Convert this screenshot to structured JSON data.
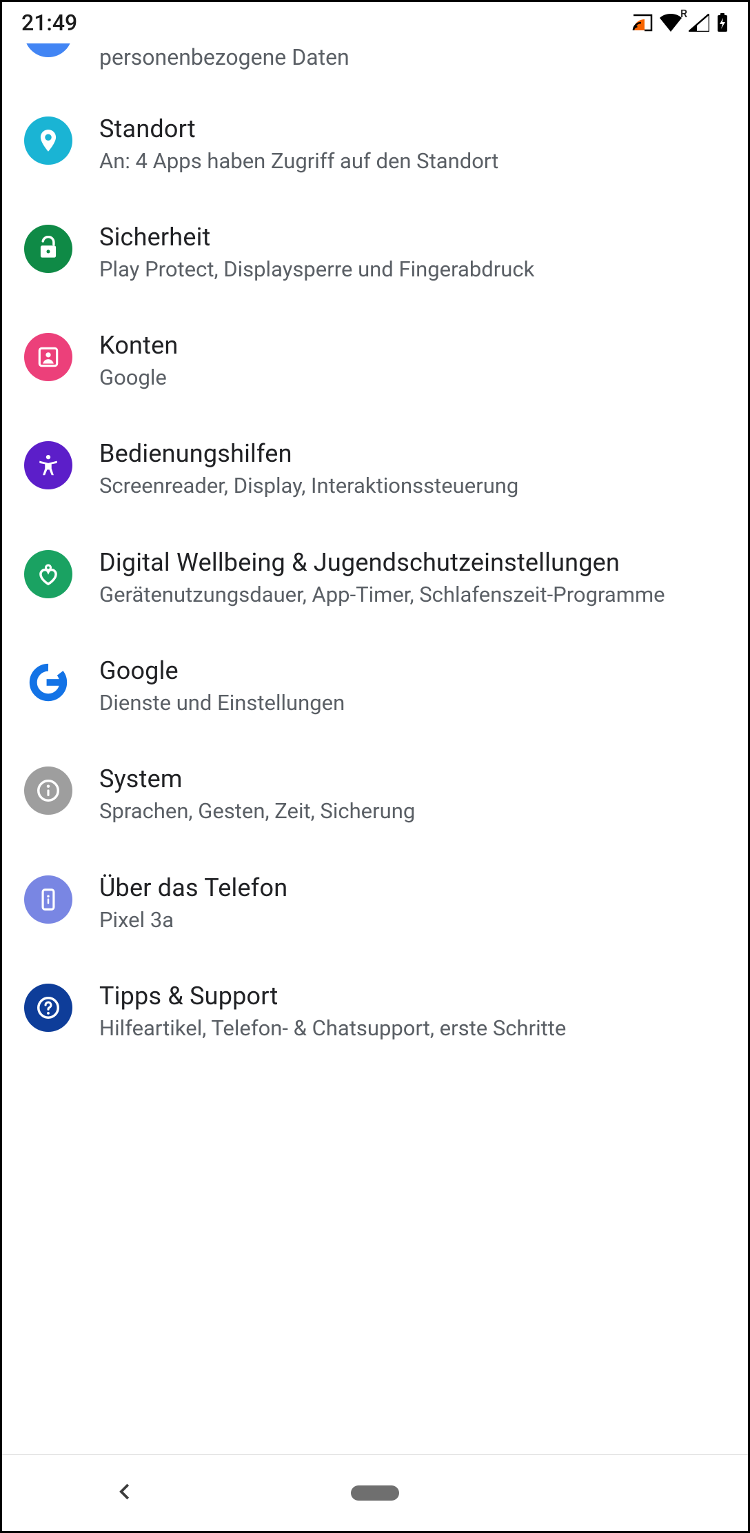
{
  "statusbar": {
    "time": "21:49",
    "signal_label": "R"
  },
  "partial": {
    "subtitle_fragment": "personenbezogene Daten"
  },
  "menu": [
    {
      "id": "standort",
      "title": "Standort",
      "subtitle": "An: 4 Apps haben Zugriff auf den Standort",
      "icon": "location",
      "color": "#1ab4d4"
    },
    {
      "id": "sicherheit",
      "title": "Sicherheit",
      "subtitle": "Play Protect, Displaysperre und Fingerabdruck",
      "icon": "lock-open",
      "color": "#0f8a46"
    },
    {
      "id": "konten",
      "title": "Konten",
      "subtitle": "Google",
      "icon": "account",
      "color": "#ec407a"
    },
    {
      "id": "bedienung",
      "title": "Bedienungshilfen",
      "subtitle": "Screenreader, Display, Interaktionssteuerung",
      "icon": "accessibility",
      "color": "#5c1ec9"
    },
    {
      "id": "wellbeing",
      "title": "Digital Wellbeing & Jugendschutzeinstellungen",
      "subtitle": "Gerätenutzungsdauer, App-Timer, Schlafenszeit-Programme",
      "icon": "wellbeing",
      "color": "#1aa262"
    },
    {
      "id": "google",
      "title": "Google",
      "subtitle": "Dienste und Einstellungen",
      "icon": "google",
      "color": "#1373e6"
    },
    {
      "id": "system",
      "title": "System",
      "subtitle": "Sprachen, Gesten, Zeit, Sicherung",
      "icon": "info",
      "color": "#9e9e9e"
    },
    {
      "id": "about",
      "title": "Über das Telefon",
      "subtitle": "Pixel 3a",
      "icon": "phone",
      "color": "#7986e3"
    },
    {
      "id": "tipps",
      "title": "Tipps & Support",
      "subtitle": "Hilfeartikel, Telefon- & Chatsupport, erste Schritte",
      "icon": "help",
      "color": "#0e3d99"
    }
  ]
}
